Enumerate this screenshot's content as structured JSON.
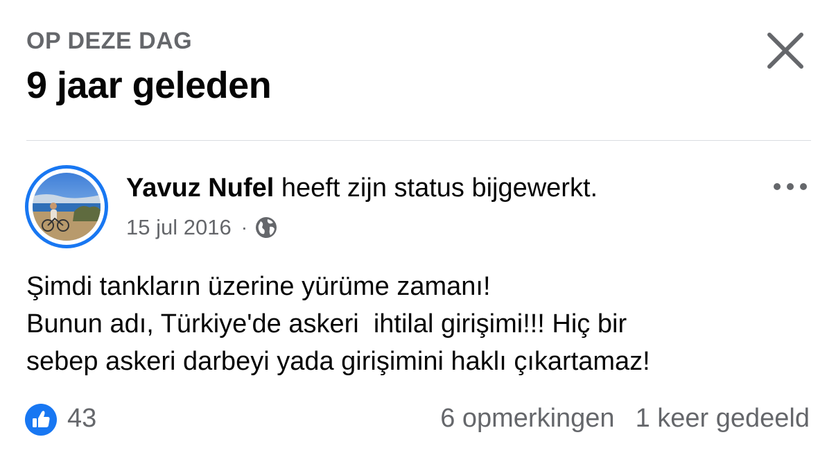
{
  "header": {
    "eyebrow": "OP DEZE DAG",
    "title": "9 jaar geleden"
  },
  "icons": {
    "close": "close-icon",
    "more": "more-options-icon",
    "audience": "globe-icon",
    "reaction": "like-icon"
  },
  "post": {
    "author": "Yavuz Nufel",
    "action": " heeft zijn status bijgewerkt.",
    "date": "15 jul 2016",
    "separator": "·",
    "body": "Şimdi tankların üzerine yürüme zamanı!\nBunun adı, Türkiye'de askeri  ihtilal girişimi!!! Hiç bir\nsebep askeri darbeyi yada girişimini haklı çıkartamaz!"
  },
  "stats": {
    "likes": "43",
    "comments": "6 opmerkingen",
    "shares": "1 keer gedeeld"
  },
  "colors": {
    "accent": "#1877f2",
    "secondary_text": "#65676b",
    "primary_text": "#050505",
    "divider": "#dadde1"
  }
}
